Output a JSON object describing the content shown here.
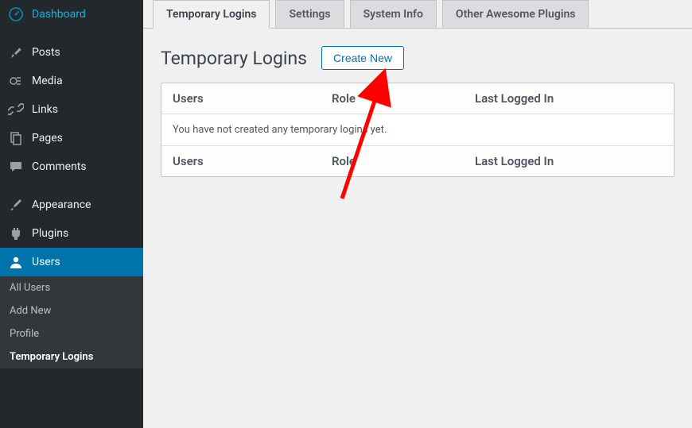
{
  "sidebar": {
    "items": [
      {
        "label": "Dashboard"
      },
      {
        "label": "Posts"
      },
      {
        "label": "Media"
      },
      {
        "label": "Links"
      },
      {
        "label": "Pages"
      },
      {
        "label": "Comments"
      },
      {
        "label": "Appearance"
      },
      {
        "label": "Plugins"
      },
      {
        "label": "Users"
      }
    ],
    "submenu": [
      {
        "label": "All Users"
      },
      {
        "label": "Add New"
      },
      {
        "label": "Profile"
      },
      {
        "label": "Temporary Logins"
      }
    ]
  },
  "tabs": [
    {
      "label": "Temporary Logins"
    },
    {
      "label": "Settings"
    },
    {
      "label": "System Info"
    },
    {
      "label": "Other Awesome Plugins"
    }
  ],
  "page": {
    "title": "Temporary Logins",
    "create_button": "Create New"
  },
  "table": {
    "headers": {
      "users": "Users",
      "role": "Role",
      "last": "Last Logged In"
    },
    "empty_message": "You have not created any temporary logins yet."
  }
}
